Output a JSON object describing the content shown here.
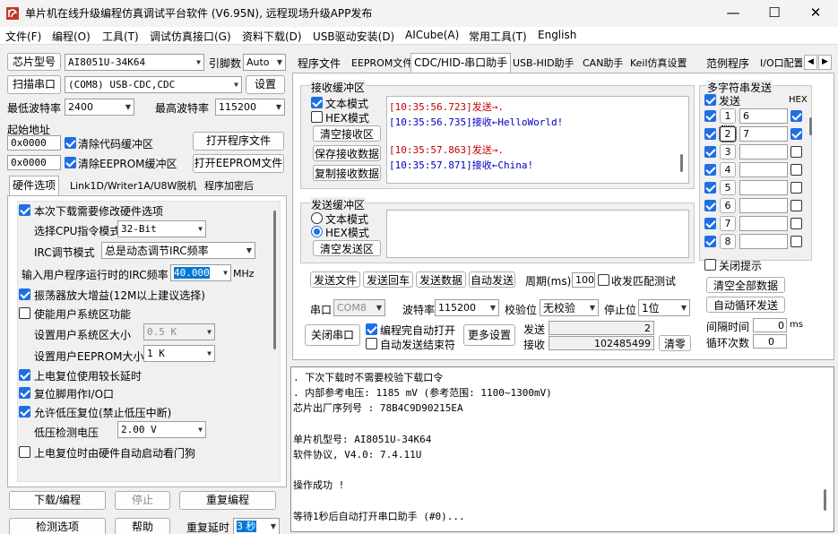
{
  "window": {
    "title": "单片机在线升级编程仿真调试平台软件 (V6.95N), 远程现场升级APP发布",
    "min": "—",
    "max": "☐",
    "close": "✕"
  },
  "menu": [
    "文件(F)",
    "编程(O)",
    "工具(T)",
    "调试仿真接口(G)",
    "资料下载(D)",
    "USB驱动安装(D)",
    "AICube(A)",
    "常用工具(T)",
    "English"
  ],
  "left": {
    "chip_label": "芯片型号",
    "chip_value": "AI8051U-34K64",
    "pins_label": "引脚数",
    "pins_value": "Auto",
    "port_btn": "扫描串口",
    "port_value": "(COM8) USB-CDC,CDC",
    "settings_btn": "设置",
    "min_baud_label": "最低波特率",
    "min_baud": "2400",
    "max_baud_label": "最高波特率",
    "max_baud": "115200",
    "start_addr_label": "起始地址",
    "addr1": "0x0000",
    "clear_code": "清除代码缓冲区",
    "open_prog": "打开程序文件",
    "addr2": "0x0000",
    "clear_eeprom": "清除EEPROM缓冲区",
    "open_eeprom": "打开EEPROM文件",
    "tabs": [
      "硬件选项",
      "Link1D/Writer1A/U8W脱机",
      "程序加密后"
    ],
    "opts": {
      "modify": "本次下载需要修改硬件选项",
      "cpu_label": "选择CPU指令模式",
      "cpu_value": "32-Bit",
      "irc_label": "IRC调节模式",
      "irc_value": "总是动态调节IRC频率",
      "freq_label": "输入用户程序运行时的IRC频率",
      "freq_value": "40.000",
      "freq_unit": "MHz",
      "osc": "振荡器放大增益(12M以上建议选择)",
      "sysarea": "使能用户系统区功能",
      "sysarea_size_label": "设置用户系统区大小",
      "sysarea_size": "0.5 K",
      "eeprom_size_label": "设置用户EEPROM大小",
      "eeprom_size": "1   K",
      "long_reset": "上电复位使用较长延时",
      "reset_io": "复位脚用作I/O口",
      "lvr": "允许低压复位(禁止低压中断)",
      "lvd_label": "低压检测电压",
      "lvd_value": "2.00 V",
      "wdt": "上电复位时由硬件自动启动看门狗"
    },
    "download_btn": "下载/编程",
    "stop_btn": "停止",
    "reprog_btn": "重复编程",
    "detect_btn": "检测选项",
    "help_btn": "帮助",
    "repeat_delay_label": "重复延时",
    "repeat_delay": "3 秒"
  },
  "right_tabs": [
    "程序文件",
    "EEPROM文件",
    "CDC/HID-串口助手",
    "USB-HID助手",
    "CAN助手",
    "Keil仿真设置",
    "范例程序",
    "I/O口配置"
  ],
  "serial": {
    "rx_group": "接收缓冲区",
    "text_mode": "文本模式",
    "hex_mode": "HEX模式",
    "clear_rx": "清空接收区",
    "save_rx": "保存接收数据",
    "copy_rx": "复制接收数据",
    "rx_lines": [
      {
        "time": "[10:35:56.723]",
        "msg": "发送→.",
        "type": "tx"
      },
      {
        "time": "[10:35:56.735]",
        "msg": "接收←HelloWorld!",
        "type": "rx"
      },
      {
        "time": "[10:35:57.863]",
        "msg": "发送→.",
        "type": "tx"
      },
      {
        "time": "[10:35:57.871]",
        "msg": "接收←China!",
        "type": "rx"
      }
    ],
    "tx_group": "发送缓冲区",
    "tx_text_mode": "文本模式",
    "tx_hex_mode": "HEX模式",
    "clear_tx": "清空发送区",
    "send_file": "发送文件",
    "send_return": "发送回车",
    "send_data": "发送数据",
    "auto_send": "自动发送",
    "period_label": "周期(ms)",
    "period": "100",
    "match_label": "收发匹配测试",
    "port_label": "串口",
    "port": "COM8",
    "baud_label": "波特率",
    "baud": "115200",
    "parity_label": "校验位",
    "parity": "无校验",
    "stop_label": "停止位",
    "stop": "1位",
    "close_btn": "关闭串口",
    "auto_open": "编程完自动打开",
    "auto_send_end": "自动发送结束符",
    "more_btn": "更多设置",
    "sent_label": "发送",
    "sent_count": "2",
    "recv_label": "接收",
    "recv_count": "102485499",
    "clear_count": "清零"
  },
  "multi": {
    "title": "多字符串发送",
    "send_col": "发送",
    "hex_col": "HEX",
    "rows": [
      {
        "n": "1",
        "v": "6",
        "c": true,
        "h": true
      },
      {
        "n": "2",
        "v": "7",
        "c": true,
        "h": true
      },
      {
        "n": "3",
        "v": "",
        "c": true,
        "h": false
      },
      {
        "n": "4",
        "v": "",
        "c": true,
        "h": false
      },
      {
        "n": "5",
        "v": "",
        "c": true,
        "h": false
      },
      {
        "n": "6",
        "v": "",
        "c": true,
        "h": false
      },
      {
        "n": "7",
        "v": "",
        "c": true,
        "h": false
      },
      {
        "n": "8",
        "v": "",
        "c": true,
        "h": false
      }
    ],
    "close_hint": "关闭提示",
    "clear_all": "清空全部数据",
    "auto_loop": "自动循环发送",
    "interval_label": "间隔时间",
    "interval": "0",
    "interval_unit": "ms",
    "loops_label": "循环次数",
    "loops": "0"
  },
  "log": [
    "  . 下次下载时不需要校验下载口令",
    "  . 内部参考电压: 1185 mV (参考范围: 1100~1300mV)",
    "芯片出厂序列号 : 78B4C9D90215EA",
    "",
    "  单片机型号: AI8051U-34K64",
    "  软件协议, V4.0: 7.4.11U",
    "",
    "操作成功 !",
    "",
    "等待1秒后自动打开串口助手 (#0)..."
  ]
}
